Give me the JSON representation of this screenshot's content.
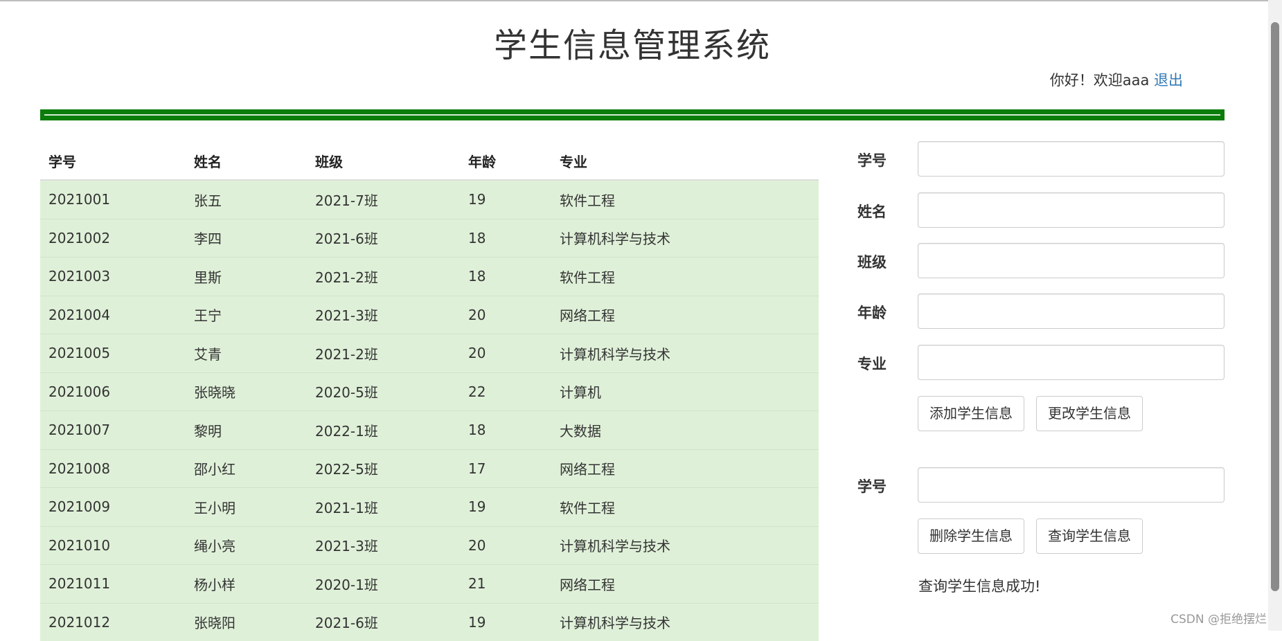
{
  "header": {
    "title": "学生信息管理系统",
    "greeting": "你好！欢迎aaa",
    "logout_link": "退出"
  },
  "table": {
    "columns": [
      "学号",
      "姓名",
      "班级",
      "年龄",
      "专业"
    ],
    "rows": [
      [
        "2021001",
        "张五",
        "2021-7班",
        "19",
        "软件工程"
      ],
      [
        "2021002",
        "李四",
        "2021-6班",
        "18",
        "计算机科学与技术"
      ],
      [
        "2021003",
        "里斯",
        "2021-2班",
        "18",
        "软件工程"
      ],
      [
        "2021004",
        "王宁",
        "2021-3班",
        "20",
        "网络工程"
      ],
      [
        "2021005",
        "艾青",
        "2021-2班",
        "20",
        "计算机科学与技术"
      ],
      [
        "2021006",
        "张晓晓",
        "2020-5班",
        "22",
        "计算机"
      ],
      [
        "2021007",
        "黎明",
        "2022-1班",
        "18",
        "大数据"
      ],
      [
        "2021008",
        "邵小红",
        "2022-5班",
        "17",
        "网络工程"
      ],
      [
        "2021009",
        "王小明",
        "2021-1班",
        "19",
        "软件工程"
      ],
      [
        "2021010",
        "绳小亮",
        "2021-3班",
        "20",
        "计算机科学与技术"
      ],
      [
        "2021011",
        "杨小样",
        "2020-1班",
        "21",
        "网络工程"
      ],
      [
        "2021012",
        "张晓阳",
        "2021-6班",
        "19",
        "计算机科学与技术"
      ]
    ]
  },
  "form": {
    "fields": [
      {
        "label": "学号",
        "value": ""
      },
      {
        "label": "姓名",
        "value": ""
      },
      {
        "label": "班级",
        "value": ""
      },
      {
        "label": "年龄",
        "value": ""
      },
      {
        "label": "专业",
        "value": ""
      }
    ],
    "add_button": "添加学生信息",
    "update_button": "更改学生信息",
    "query_field": {
      "label": "学号",
      "value": ""
    },
    "delete_button": "删除学生信息",
    "search_button": "查询学生信息",
    "status_message": "查询学生信息成功!"
  },
  "watermark": "CSDN @拒绝摆烂",
  "colors": {
    "header_bar": "#0a7d0a",
    "row_background": "#dff0d8",
    "link": "#337ab7"
  }
}
